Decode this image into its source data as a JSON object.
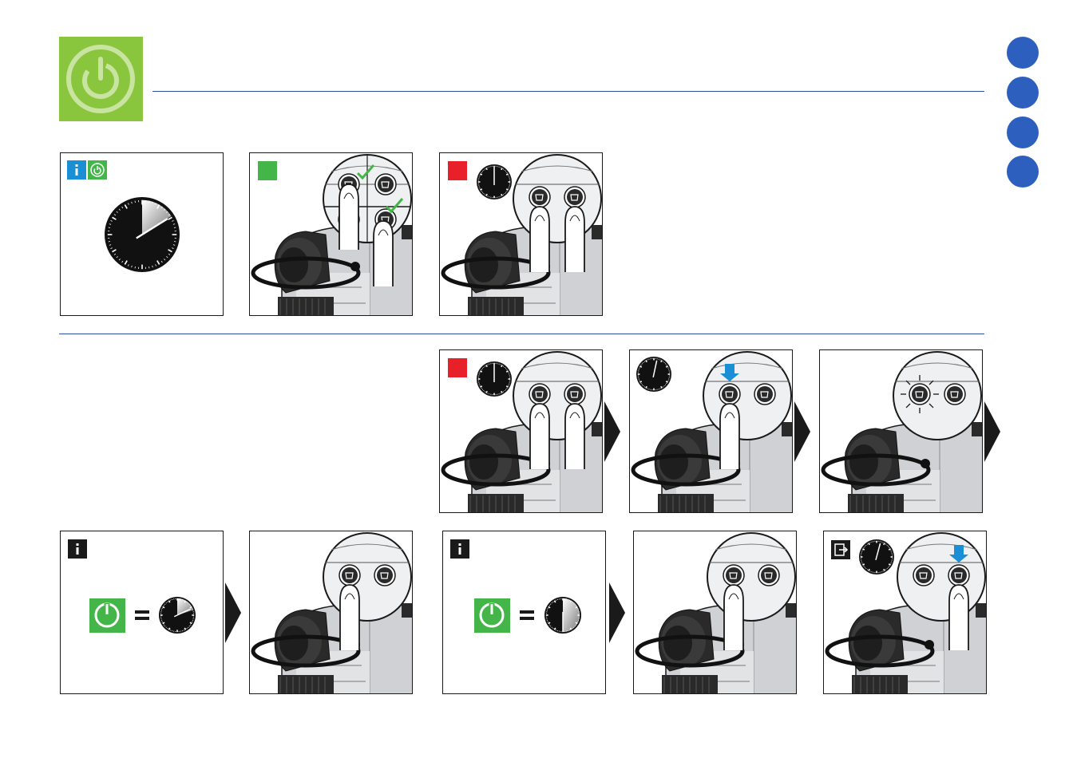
{
  "colors": {
    "header_green": "#8ac53e",
    "rule_blue": "#2f4fa3",
    "nav_blue": "#2d5fbf",
    "info_blue": "#1a8fd6",
    "ok_green": "#44b649",
    "stop_red": "#e8202a",
    "press_blue": "#1a8fd6"
  },
  "header": {
    "icon": "power-icon"
  },
  "nav_dots": [
    {
      "id": "nav-1"
    },
    {
      "id": "nav-2"
    },
    {
      "id": "nav-3"
    },
    {
      "id": "nav-4"
    }
  ],
  "panels": [
    {
      "id": "info-timer",
      "icons": [
        "info-icon",
        "power-icon",
        "stopwatch-icon"
      ]
    },
    {
      "id": "machine-check",
      "icons": [
        "green-status-square",
        "checkmark-icon"
      ]
    },
    {
      "id": "machine-hold-both",
      "icons": [
        "red-status-square",
        "stopwatch-icon"
      ]
    },
    {
      "id": "row2-hold-both",
      "icons": [
        "red-status-square",
        "stopwatch-icon"
      ]
    },
    {
      "id": "row2-press-left",
      "icons": [
        "stopwatch-icon",
        "down-arrow-icon"
      ]
    },
    {
      "id": "row2-blink-left",
      "icons": [
        "blinking-light-icon"
      ]
    },
    {
      "id": "info-power-eq-short",
      "icons": [
        "info-icon",
        "power-icon",
        "equals-icon",
        "stopwatch-icon"
      ]
    },
    {
      "id": "machine-press-left",
      "icons": []
    },
    {
      "id": "info-power-eq-long",
      "icons": [
        "info-icon",
        "power-icon",
        "equals-icon",
        "stopwatch-icon"
      ]
    },
    {
      "id": "machine-press-left-2",
      "icons": []
    },
    {
      "id": "exit-press-right",
      "icons": [
        "exit-icon",
        "stopwatch-icon",
        "down-arrow-icon"
      ]
    }
  ]
}
